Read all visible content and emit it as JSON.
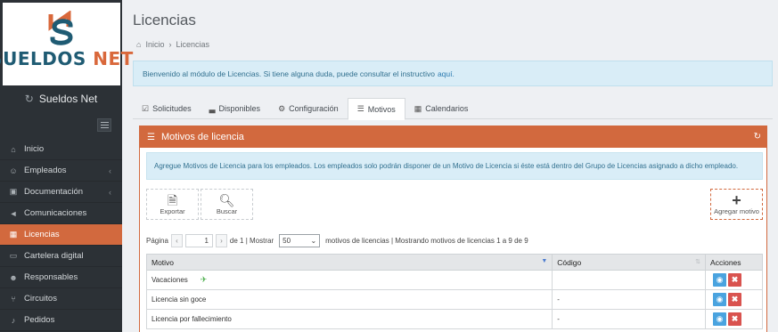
{
  "sidebar": {
    "logo": {
      "part1": "SUELDOS",
      "part2": "NET"
    },
    "brand": "Sueldos Net",
    "items": [
      {
        "label": "Inicio",
        "icon": "home-icon",
        "arrow": false,
        "active": false
      },
      {
        "label": "Empleados",
        "icon": "users-icon",
        "arrow": true,
        "active": false
      },
      {
        "label": "Documentación",
        "icon": "folder-icon",
        "arrow": true,
        "active": false
      },
      {
        "label": "Comunicaciones",
        "icon": "megaphone-icon",
        "arrow": false,
        "active": false
      },
      {
        "label": "Licencias",
        "icon": "calendar-icon",
        "arrow": false,
        "active": true
      },
      {
        "label": "Cartelera digital",
        "icon": "board-icon",
        "arrow": false,
        "active": false
      },
      {
        "label": "Responsables",
        "icon": "person-icon",
        "arrow": false,
        "active": false
      },
      {
        "label": "Circuitos",
        "icon": "branch-icon",
        "arrow": false,
        "active": false
      },
      {
        "label": "Pedidos",
        "icon": "bell-icon",
        "arrow": false,
        "active": false
      }
    ]
  },
  "page": {
    "title": "Licencias",
    "breadcrumb": [
      "Inicio",
      "Licencias"
    ],
    "alert_text": "Bienvenido al módulo de Licencias. Si tiene alguna duda, puede consultar el instructivo",
    "alert_link": "aquí."
  },
  "tabs": [
    {
      "label": "Solicitudes",
      "icon": "list-check-icon"
    },
    {
      "label": "Disponibles",
      "icon": "bar-chart-icon"
    },
    {
      "label": "Configuración",
      "icon": "gear-icon"
    },
    {
      "label": "Motivos",
      "icon": "list-icon"
    },
    {
      "label": "Calendarios",
      "icon": "calendar-icon"
    }
  ],
  "panel": {
    "title": "Motivos de licencia",
    "info": "Agregue Motivos de Licencia para los empleados. Los empleados solo podrán disponer de un Motivo de Licencia si éste está dentro del Grupo de Licencias asignado a dicho empleado.",
    "buttons": {
      "export": "Exportar",
      "search": "Buscar",
      "add": "Agregar motivo"
    },
    "pager": {
      "page_label": "Página",
      "page_value": "1",
      "of_text": "de 1 | Mostrar",
      "per_page": "50",
      "summary": "motivos de licencias | Mostrando motivos de licencias 1 a 9 de 9"
    },
    "columns": [
      "Motivo",
      "Código",
      "Acciones"
    ],
    "rows": [
      {
        "motivo": "Vacaciones",
        "codigo": "",
        "vacation": true
      },
      {
        "motivo": "Licencia sin goce",
        "codigo": "-",
        "vacation": false
      },
      {
        "motivo": "Licencia por fallecimiento",
        "codigo": "-",
        "vacation": false
      }
    ]
  },
  "colors": {
    "accent": "#d2693e",
    "sidebar": "#2c3136",
    "info_bg": "#d9edf7"
  }
}
